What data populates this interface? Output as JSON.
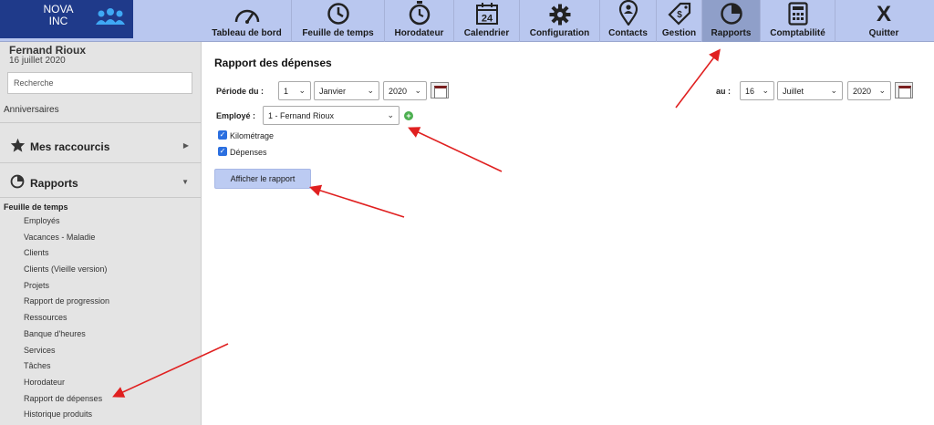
{
  "brand": {
    "logo_line1": "NOVA",
    "logo_line2": "INC"
  },
  "nav": [
    {
      "label": "Tableau de bord",
      "icon": "gauge-icon"
    },
    {
      "label": "Feuille de temps",
      "icon": "clock-icon"
    },
    {
      "label": "Horodateur",
      "icon": "stopwatch-icon"
    },
    {
      "label": "Calendrier",
      "icon": "calendar-icon",
      "icon_text": "24"
    },
    {
      "label": "Configuration",
      "icon": "gear-icon"
    },
    {
      "label": "Contacts",
      "icon": "contact-pin-icon"
    },
    {
      "label": "Gestion",
      "icon": "dollar-tag-icon"
    },
    {
      "label": "Rapports",
      "icon": "pie-chart-icon"
    },
    {
      "label": "Comptabilité",
      "icon": "calculator-icon"
    },
    {
      "label": "Quitter",
      "icon": "close-icon",
      "icon_text": "X"
    }
  ],
  "active_nav": "Rapports",
  "sidebar": {
    "user_name": "Fernand Rioux",
    "user_date": "16 juillet 2020",
    "search_placeholder": "Recherche",
    "anniversaires": "Anniversaires",
    "shortcuts_label": "Mes raccourcis",
    "reports_label": "Rapports",
    "group_title": "Feuille de temps",
    "items": [
      "Employés",
      "Vacances - Maladie",
      "Clients",
      "Clients (Vieille version)",
      "Projets",
      "Rapport de progression",
      "Ressources",
      "Banque d'heures",
      "Services",
      "Tâches",
      "Horodateur",
      "Rapport de dépenses",
      "Historique produits"
    ]
  },
  "main": {
    "title": "Rapport des dépenses",
    "period_label": "Période du :",
    "from": {
      "day": "1",
      "month": "Janvier",
      "year": "2020"
    },
    "to_label": "au :",
    "to": {
      "day": "16",
      "month": "Juillet",
      "year": "2020"
    },
    "employee_label": "Employé :",
    "employee_value": "1 - Fernand Rioux",
    "checkboxes": [
      {
        "label": "Kilométrage",
        "checked": true
      },
      {
        "label": "Dépenses",
        "checked": true
      }
    ],
    "show_button": "Afficher le rapport"
  },
  "colors": {
    "topbar": "#b9c7ef",
    "logo_bg": "#1f3a8a",
    "active_tab": "#8f9fc9",
    "sidebar_bg": "#e4e4e4",
    "button_bg": "#bccbf2",
    "annotation_arrow": "#e02020"
  }
}
